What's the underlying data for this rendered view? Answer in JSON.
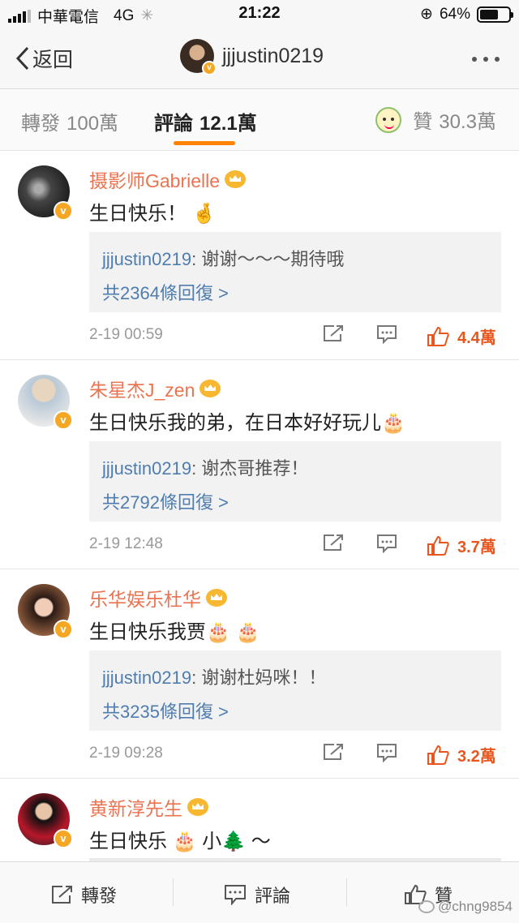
{
  "status_bar": {
    "carrier": "中華電信",
    "network": "4G",
    "time": "21:22",
    "battery_percent": "64%",
    "battery_level": 0.64
  },
  "nav": {
    "back_label": "返回",
    "title": "jjjustin0219"
  },
  "tabs": {
    "reposts_label": "轉發",
    "reposts_count": "100萬",
    "comments_label": "評論",
    "comments_count": "12.1萬",
    "likes_label": "贊",
    "likes_count": "30.3萬"
  },
  "comments": [
    {
      "author": "摄影师Gabrielle",
      "text": "生日快乐！",
      "emoji": "🤞",
      "reply_user": "jjjustin0219",
      "reply_text": "谢谢～～～期待哦",
      "reply_count": "共2364條回復 >",
      "time": "2-19 00:59",
      "likes": "4.4萬"
    },
    {
      "author": "朱星杰J_zen",
      "text": "生日快乐我的弟，在日本好好玩儿",
      "emoji": "🎂",
      "reply_user": "jjjustin0219",
      "reply_text": "谢杰哥推荐！",
      "reply_count": "共2792條回復 >",
      "time": "2-19 12:48",
      "likes": "3.7萬"
    },
    {
      "author": "乐华娱乐杜华",
      "text": "生日快乐我贾",
      "emoji": "🎂 🎂",
      "reply_user": "jjjustin0219",
      "reply_text": "谢谢杜妈咪！！",
      "reply_count": "共3235條回復 >",
      "time": "2-19 09:28",
      "likes": "3.2萬"
    },
    {
      "author": "黄新淳先生",
      "text": "生日快乐 🎂 小🌲 ～"
    }
  ],
  "bottom_bar": {
    "repost_label": "轉發",
    "comment_label": "評論",
    "like_label": "贊",
    "watermark": "@chng9854"
  },
  "icons": {
    "back": "chevron-left-icon",
    "more": "more-dots-icon",
    "share": "share-icon",
    "reply": "comment-icon",
    "like": "thumbs-up-icon",
    "verified": "verified-badge-icon",
    "vip": "crown-icon"
  },
  "colors": {
    "accent": "#ff8200",
    "author": "#eb7350",
    "link": "#507daf",
    "like": "#e8561e"
  }
}
